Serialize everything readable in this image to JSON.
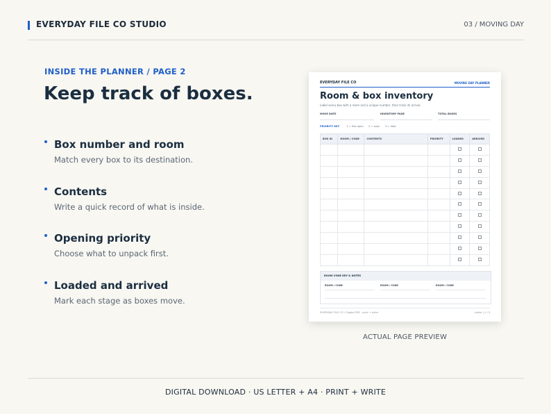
{
  "header": {
    "brand": "EVERYDAY FILE CO STUDIO",
    "page_label": "03 / MOVING DAY"
  },
  "eyebrow": "INSIDE THE PLANNER / PAGE 2",
  "headline": "Keep track of boxes.",
  "features": [
    {
      "title": "Box number and room",
      "desc": "Match every box to its destination."
    },
    {
      "title": "Contents",
      "desc": "Write a quick record of what is inside."
    },
    {
      "title": "Opening priority",
      "desc": "Choose what to unpack first."
    },
    {
      "title": "Loaded and arrived",
      "desc": "Mark each stage as boxes move."
    }
  ],
  "preview": {
    "brand": "EVERYDAY FILE CO",
    "tag": "MOVING DAY PLANNER",
    "title": "Room & box inventory",
    "subtitle": "Label every box with a room and a unique number, then track its arrival.",
    "fields": [
      "MOVE DATE",
      "INVENTORY PAGE",
      "TOTAL BOXES"
    ],
    "priority_key": "PRIORITY KEY",
    "priority_items": [
      "1 = first open",
      "2 = soon",
      "3 = later"
    ],
    "columns": [
      "BOX ID",
      "ROOM / CODE",
      "CONTENTS",
      "PRIORITY",
      "LOADED",
      "ARRIVED"
    ],
    "row_count": 11,
    "notes_title": "ROOM CODE KEY & NOTES",
    "notes_labels": [
      "ROOM / CODE",
      "ROOM / CODE",
      "ROOM / CODE"
    ],
    "footer_left": "EVERYDAY FILE CO  •  Digital PDF · print + write",
    "footer_right": "Letter  |  2 / 3"
  },
  "caption": "ACTUAL PAGE PREVIEW",
  "footer": "DIGITAL DOWNLOAD · US LETTER + A4 · PRINT + WRITE",
  "colors": {
    "accent": "#1f5fc9",
    "background": "#f8f7f2",
    "heading": "#1b2e40"
  }
}
